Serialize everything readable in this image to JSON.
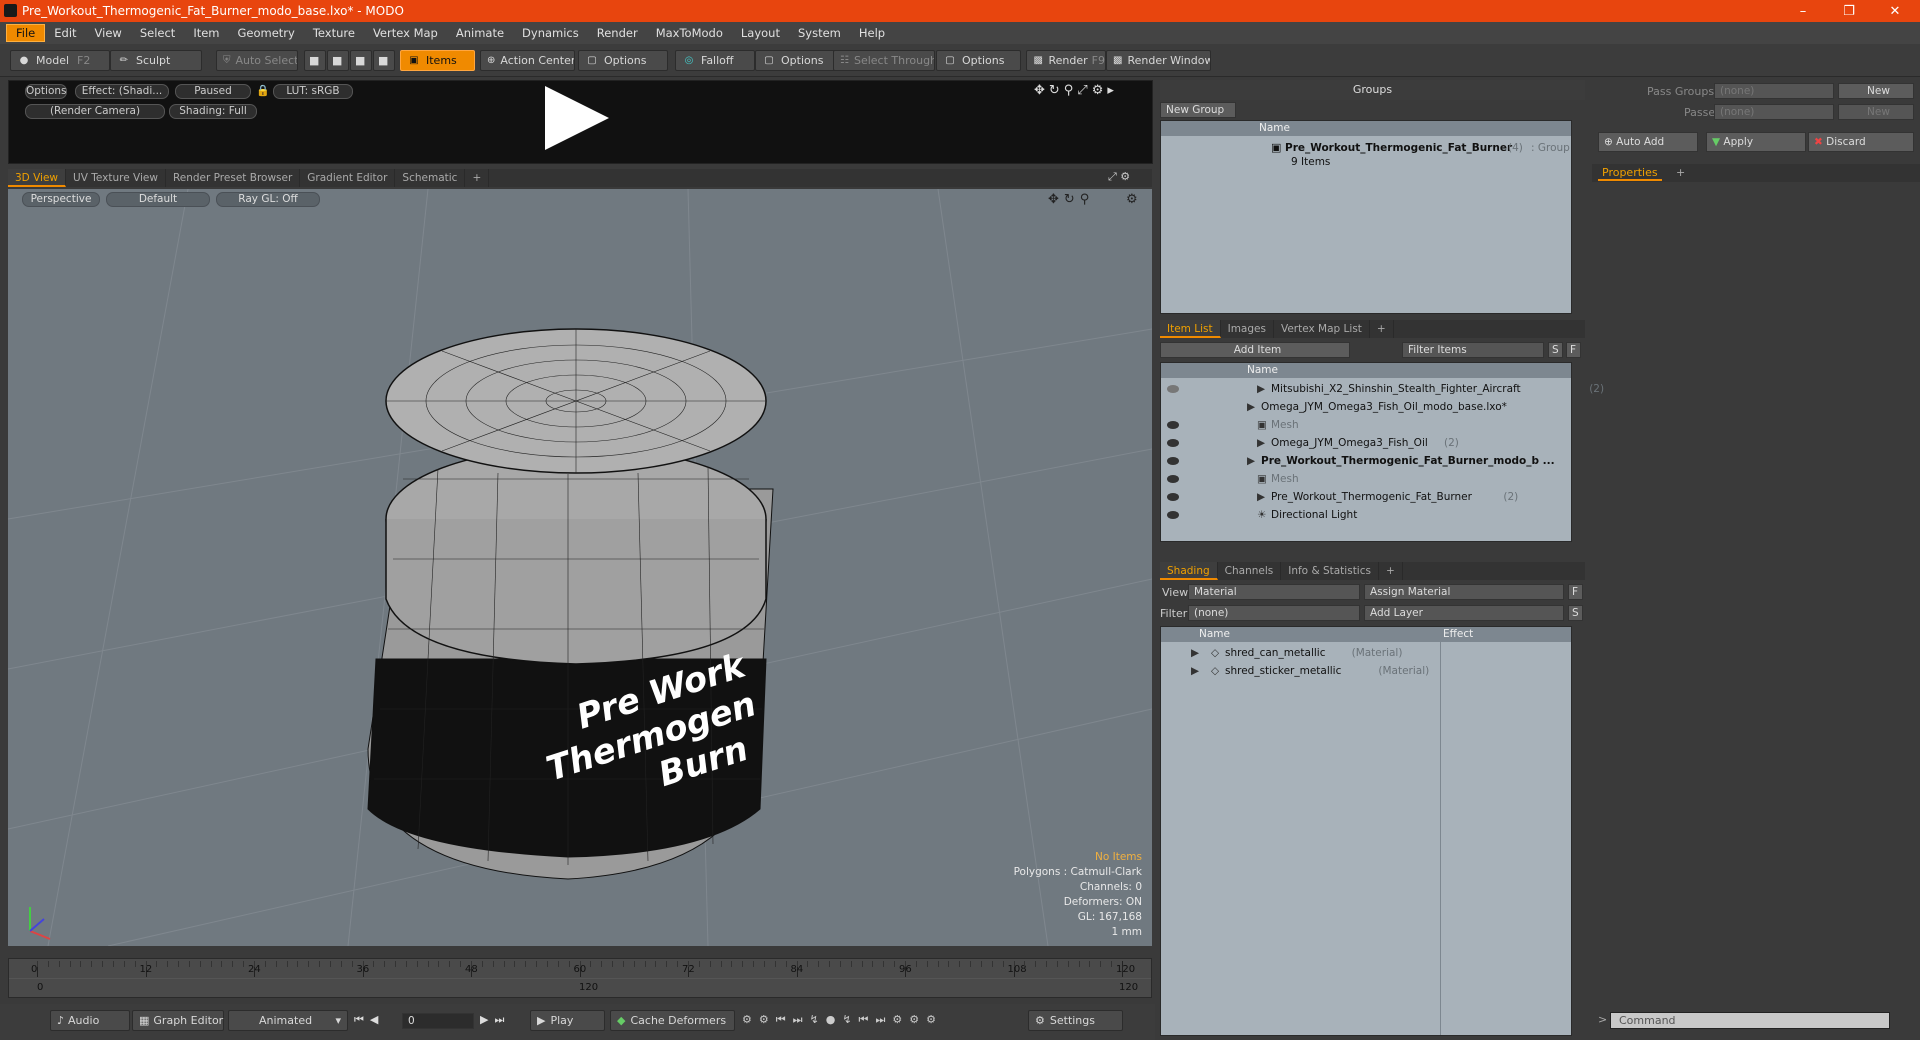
{
  "window": {
    "title": "Pre_Workout_Thermogenic_Fat_Burner_modo_base.lxo* - MODO"
  },
  "menu": [
    "File",
    "Edit",
    "View",
    "Select",
    "Item",
    "Geometry",
    "Texture",
    "Vertex Map",
    "Animate",
    "Dynamics",
    "Render",
    "MaxToModo",
    "Layout",
    "System",
    "Help"
  ],
  "toolbar": {
    "model": "Model",
    "model_key": "F2",
    "sculpt": "Sculpt",
    "auto_select": "Auto Select",
    "items": "Items",
    "action_center": "Action Center",
    "options1": "Options",
    "falloff": "Falloff",
    "options2": "Options",
    "select_through": "Select Through",
    "options3": "Options",
    "render": "Render",
    "render_key": "F9",
    "render_window": "Render Window"
  },
  "preview": {
    "options": "Options",
    "effect": "Effect: (Shadi...",
    "paused": "Paused",
    "lut": "LUT: sRGB",
    "camera": "(Render Camera)",
    "shading": "Shading: Full"
  },
  "viewtabs": [
    "3D View",
    "UV Texture View",
    "Render Preset Browser",
    "Gradient Editor",
    "Schematic",
    "+"
  ],
  "viewport": {
    "perspective": "Perspective",
    "default": "Default",
    "raygl": "Ray GL: Off",
    "label_lines": [
      "Pre Work",
      "Thermogen",
      "Burn"
    ]
  },
  "stats": {
    "no_items": "No Items",
    "polygons": "Polygons : Catmull-Clark",
    "channels": "Channels: 0",
    "deformers": "Deformers: ON",
    "gl": "GL: 167,168",
    "scale": "1 mm"
  },
  "timeline": {
    "ticks": [
      "0",
      "12",
      "24",
      "36",
      "48",
      "60",
      "72",
      "84",
      "96",
      "108",
      "120"
    ],
    "sub_ticks": [
      "0",
      "120",
      "120"
    ]
  },
  "bottom": {
    "audio": "Audio",
    "graph_editor": "Graph Editor",
    "animated": "Animated",
    "frame": "0",
    "play": "Play",
    "cache": "Cache Deformers",
    "settings": "Settings"
  },
  "groups": {
    "title": "Groups",
    "new_group": "New Group",
    "col_name": "Name",
    "item_name": "Pre_Workout_Thermogenic_Fat_Burner",
    "item_count": "(4)",
    "item_type": ": Group",
    "item_sub": "9 Items"
  },
  "passes": {
    "pass_groups": "Pass Groups",
    "pass_none": "(none)",
    "passes": "Passes",
    "passes_none": "(none)",
    "new1": "New",
    "new2": "New",
    "auto_add": "Auto Add",
    "apply": "Apply",
    "discard": "Discard",
    "properties": "Properties",
    "plus": "+"
  },
  "itemlist": {
    "tabs": [
      "Item List",
      "Images",
      "Vertex Map List",
      "+"
    ],
    "add_item": "Add Item",
    "filter": "Filter Items",
    "s": "S",
    "f": "F",
    "col_name": "Name",
    "rows": [
      {
        "name": "Mitsubishi_X2_Shinshin_Stealth_Fighter_Aircraft",
        "count": "(2)"
      },
      {
        "name": "Omega_JYM_Omega3_Fish_Oil_modo_base.lxo*",
        "count": ""
      },
      {
        "name": "Mesh",
        "count": ""
      },
      {
        "name": "Omega_JYM_Omega3_Fish_Oil",
        "count": "(2)"
      },
      {
        "name": "Pre_Workout_Thermogenic_Fat_Burner_modo_b ...",
        "count": ""
      },
      {
        "name": "Mesh",
        "count": ""
      },
      {
        "name": "Pre_Workout_Thermogenic_Fat_Burner",
        "count": "(2)"
      },
      {
        "name": "Directional Light",
        "count": ""
      }
    ]
  },
  "shading": {
    "tabs": [
      "Shading",
      "Channels",
      "Info & Statistics",
      "+"
    ],
    "view_label": "View",
    "view_value": "Material",
    "assign": "Assign Material",
    "filter_label": "Filter",
    "filter_value": "(none)",
    "add_layer": "Add Layer",
    "f": "F",
    "s": "S",
    "col_name": "Name",
    "col_effect": "Effect",
    "rows": [
      {
        "name": "shred_can_metallic",
        "type": "(Material)"
      },
      {
        "name": "shred_sticker_metallic",
        "type": "(Material)"
      }
    ]
  },
  "command": {
    "placeholder": "Command"
  }
}
